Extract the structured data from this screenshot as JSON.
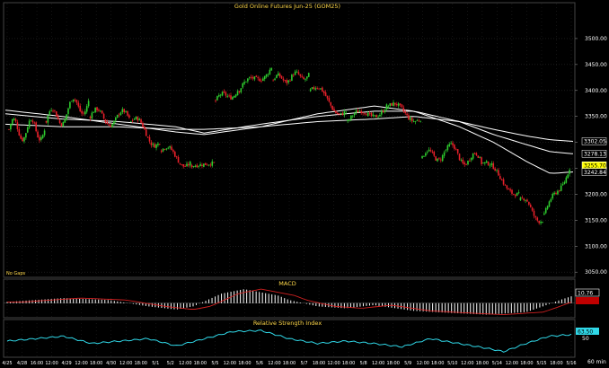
{
  "chart_data": {
    "type": "candlestick",
    "title": "Gold Online Futures Jun-25 (GOM25)",
    "interval": "60 min",
    "note_text": "No Gaps",
    "price_axis": {
      "ylim": [
        3040,
        3550
      ],
      "ticks": [
        3050,
        3100,
        3150,
        3200,
        3250,
        3300,
        3350,
        3400,
        3450,
        3500
      ]
    },
    "last_labels": [
      {
        "value": "3302.05",
        "price": 3302.05,
        "style": "white"
      },
      {
        "value": "3278.13",
        "price": 3278.13,
        "style": "white"
      },
      {
        "value": "3255.70",
        "price": 3255.7,
        "style": "yellow"
      },
      {
        "value": "3242.84",
        "price": 3242.84,
        "style": "white"
      }
    ],
    "segments": [
      {
        "n": 22,
        "start": 3325,
        "end": 3325,
        "amp": 20,
        "cycles": 2
      },
      {
        "n": 26,
        "start": 3340,
        "end": 3380,
        "amp": 20,
        "cycles": 2
      },
      {
        "n": 24,
        "start": 3350,
        "end": 3345,
        "amp": 15,
        "cycles": 1.5
      },
      {
        "n": 18,
        "start": 3340,
        "end": 3300,
        "amp": 15,
        "cycles": 1
      },
      {
        "n": 18,
        "start": 3285,
        "end": 3260,
        "amp": 12,
        "cycles": 1
      },
      {
        "n": 14,
        "start": 3255,
        "end": 3260,
        "amp": 5,
        "cycles": 0
      },
      {
        "n": 14,
        "start": 3380,
        "end": 3400,
        "amp": 8,
        "cycles": 1
      },
      {
        "n": 20,
        "start": 3400,
        "end": 3445,
        "amp": 10,
        "cycles": 1
      },
      {
        "n": 22,
        "start": 3420,
        "end": 3430,
        "amp": 8,
        "cycles": 2
      },
      {
        "n": 22,
        "start": 3400,
        "end": 3360,
        "amp": 15,
        "cycles": 1
      },
      {
        "n": 24,
        "start": 3340,
        "end": 3370,
        "amp": 12,
        "cycles": 1
      },
      {
        "n": 20,
        "start": 3370,
        "end": 3345,
        "amp": 10,
        "cycles": 1
      },
      {
        "n": 14,
        "start": 3270,
        "end": 3280,
        "amp": 12,
        "cycles": 1
      },
      {
        "n": 22,
        "start": 3285,
        "end": 3260,
        "amp": 15,
        "cycles": 1.5
      },
      {
        "n": 22,
        "start": 3260,
        "end": 3200,
        "amp": 10,
        "cycles": 1
      },
      {
        "n": 14,
        "start": 3190,
        "end": 3150,
        "amp": 10,
        "cycles": 1
      },
      {
        "n": 16,
        "start": 3160,
        "end": 3250,
        "amp": 8,
        "cycles": 1
      }
    ],
    "ma_lines": [
      {
        "points": [
          [
            3362,
            0
          ],
          [
            3350,
            0.1
          ],
          [
            3335,
            0.2
          ],
          [
            3320,
            0.3
          ],
          [
            3315,
            0.35
          ],
          [
            3330,
            0.45
          ],
          [
            3355,
            0.55
          ],
          [
            3370,
            0.65
          ],
          [
            3360,
            0.72
          ],
          [
            3330,
            0.8
          ],
          [
            3300,
            0.86
          ],
          [
            3262,
            0.92
          ],
          [
            3240,
            0.96
          ],
          [
            3243,
            1
          ]
        ]
      },
      {
        "points": [
          [
            3355,
            0
          ],
          [
            3345,
            0.1
          ],
          [
            3340,
            0.2
          ],
          [
            3330,
            0.3
          ],
          [
            3318,
            0.35
          ],
          [
            3335,
            0.45
          ],
          [
            3350,
            0.55
          ],
          [
            3360,
            0.65
          ],
          [
            3360,
            0.72
          ],
          [
            3340,
            0.8
          ],
          [
            3315,
            0.86
          ],
          [
            3295,
            0.92
          ],
          [
            3282,
            0.96
          ],
          [
            3278,
            1
          ]
        ]
      },
      {
        "points": [
          [
            3335,
            0
          ],
          [
            3330,
            0.1
          ],
          [
            3330,
            0.2
          ],
          [
            3325,
            0.3
          ],
          [
            3325,
            0.35
          ],
          [
            3330,
            0.45
          ],
          [
            3340,
            0.55
          ],
          [
            3345,
            0.65
          ],
          [
            3350,
            0.72
          ],
          [
            3340,
            0.8
          ],
          [
            3325,
            0.86
          ],
          [
            3312,
            0.92
          ],
          [
            3305,
            0.96
          ],
          [
            3302,
            1
          ]
        ]
      }
    ],
    "macd": {
      "title": "MACD",
      "label_pos": "10.76",
      "label_neg": "",
      "ylim": [
        -20,
        25
      ],
      "value_profile": [
        [
          2,
          0
        ],
        [
          8,
          0.1
        ],
        [
          5,
          0.18
        ],
        [
          -5,
          0.25
        ],
        [
          -10,
          0.3
        ],
        [
          -5,
          0.33
        ],
        [
          15,
          0.38
        ],
        [
          22,
          0.42
        ],
        [
          12,
          0.48
        ],
        [
          5,
          0.5
        ],
        [
          -5,
          0.55
        ],
        [
          -8,
          0.6
        ],
        [
          -3,
          0.65
        ],
        [
          -12,
          0.72
        ],
        [
          -15,
          0.78
        ],
        [
          -18,
          0.85
        ],
        [
          -14,
          0.92
        ],
        [
          -5,
          0.95
        ],
        [
          5,
          0.98
        ],
        [
          10.76,
          1
        ]
      ]
    },
    "rsi": {
      "title": "Relative Strength Index",
      "label_value": "63.50",
      "ticks": [
        "50"
      ],
      "ylim": [
        20,
        80
      ],
      "points": [
        [
          50,
          0
        ],
        [
          55,
          0.05
        ],
        [
          60,
          0.1
        ],
        [
          45,
          0.15
        ],
        [
          50,
          0.2
        ],
        [
          55,
          0.25
        ],
        [
          40,
          0.3
        ],
        [
          55,
          0.35
        ],
        [
          70,
          0.4
        ],
        [
          72,
          0.45
        ],
        [
          55,
          0.5
        ],
        [
          45,
          0.55
        ],
        [
          50,
          0.6
        ],
        [
          45,
          0.65
        ],
        [
          38,
          0.7
        ],
        [
          55,
          0.75
        ],
        [
          45,
          0.8
        ],
        [
          35,
          0.85
        ],
        [
          28,
          0.88
        ],
        [
          45,
          0.92
        ],
        [
          60,
          0.96
        ],
        [
          63.5,
          1
        ]
      ]
    },
    "x_labels": [
      "4/25",
      "4/28",
      "16:00",
      "12:00",
      "4/29",
      "12:00",
      "18:00",
      "4/30",
      "12:00",
      "18:00",
      "5/1",
      "5/2",
      "12:00",
      "18:00",
      "5/5",
      "12:00",
      "18:00",
      "5/6",
      "12:00",
      "18:00",
      "5/7",
      "18:00",
      "12:00",
      "18:00",
      "5/8",
      "12:00",
      "18:00",
      "5/9",
      "12:00",
      "18:00",
      "5/10",
      "12:00",
      "18:00",
      "5/14",
      "12:00",
      "18:00",
      "5/15",
      "18:00",
      "5/16"
    ],
    "colors": {
      "up": "#2ecc2e",
      "down": "#e8202a",
      "grid": "#2a2a2a",
      "text": "#ffd84a",
      "rsi": "#30d8e8",
      "ma": "#ffffff",
      "axis_text": "#ffffff",
      "label_yellow": "#ffff00"
    }
  }
}
